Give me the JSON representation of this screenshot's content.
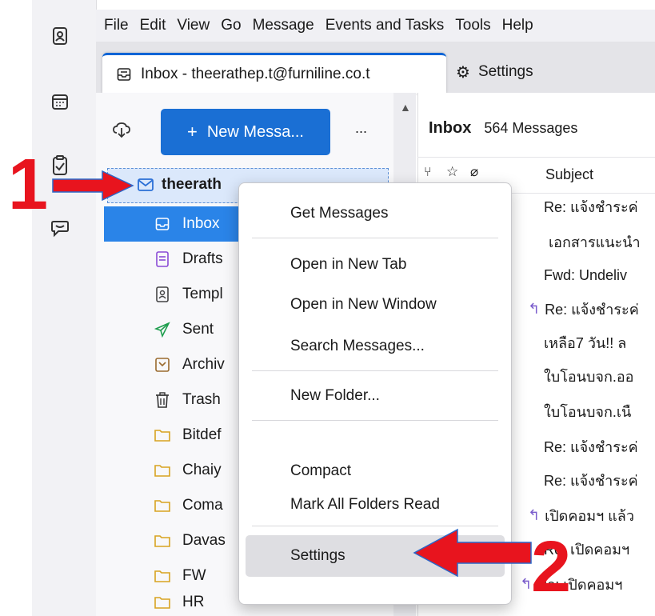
{
  "menubar": [
    "File",
    "Edit",
    "View",
    "Go",
    "Message",
    "Events and Tasks",
    "Tools",
    "Help"
  ],
  "tabs": {
    "inbox": "Inbox - theerathep.t@furniline.co.t",
    "settings": "Settings"
  },
  "folderpane": {
    "new_message": "New Messa...",
    "more": "...",
    "account": "theerath",
    "folders": [
      "Inbox",
      "Drafts",
      "Templ",
      "Sent",
      "Archiv",
      "Trash",
      "Bitdef",
      "Chaiy",
      "Coma",
      "Davas",
      "FW",
      "HR"
    ]
  },
  "messages": {
    "title": "Inbox",
    "count": "564 Messages",
    "subject_header": "Subject",
    "rows": [
      "Re: แจ้งชำระค่",
      "เอกสารแนะนำ",
      "Fwd: Undeliv",
      "Re: แจ้งชำระค่",
      "เหลือ7 วัน!! ล",
      "ใบโอนบจก.ออ",
      "ใบโอนบจก.เนื",
      "Re: แจ้งชำระค่",
      "Re: แจ้งชำระค่",
      "เปิดคอมฯ แล้ว",
      "Re: เปิดคอมฯ",
      "Re: เปิดคอมฯ"
    ]
  },
  "context_menu": [
    "Get Messages",
    "Open in New Tab",
    "Open in New Window",
    "Search Messages...",
    "New Folder...",
    "Compact",
    "Mark All Folders Read",
    "Settings"
  ],
  "annotations": {
    "step1": "1",
    "step2": "2"
  },
  "colors": {
    "accent": "#1a6fd4",
    "arrow": "#e8141e"
  }
}
